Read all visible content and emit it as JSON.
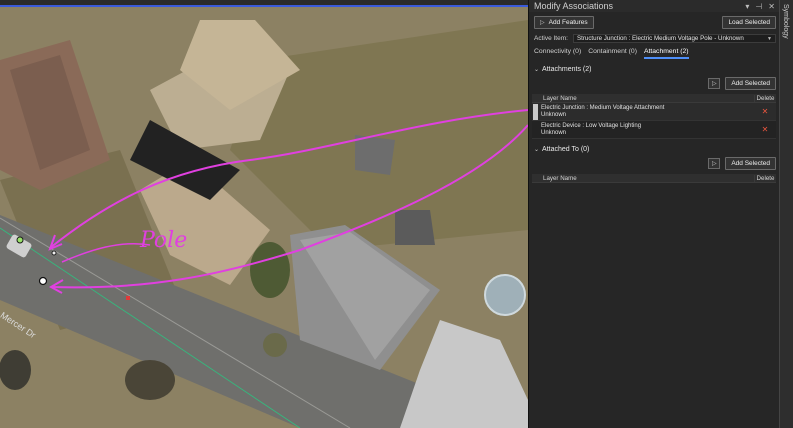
{
  "panel": {
    "title": "Modify Associations",
    "title_icons": [
      "chevron-down-icon",
      "pin-icon",
      "close-icon"
    ],
    "add_features_label": "Add Features",
    "load_selected_label": "Load Selected",
    "active_item_label": "Active Item:",
    "active_item_value": "Structure Junction : Electric Medium Voltage Pole - Unknown",
    "tabs": [
      {
        "label": "Connectivity (0)",
        "active": false
      },
      {
        "label": "Containment (0)",
        "active": false
      },
      {
        "label": "Attachment (2)",
        "active": true
      }
    ],
    "attachments": {
      "header": "Attachments (2)",
      "add_selected_label": "Add Selected",
      "columns": [
        "Layer Name",
        "Delete"
      ],
      "rows": [
        {
          "line1": "Electric Junction : Medium Voltage Attachment",
          "line2": "Unknown",
          "delete": "✕"
        },
        {
          "line1": "Electric Device : Low Voltage Lighting",
          "line2": "Unknown",
          "delete": "✕"
        }
      ]
    },
    "attached_to": {
      "header": "Attached To (0)",
      "add_selected_label": "Add Selected",
      "columns": [
        "Layer Name",
        "Delete"
      ]
    }
  },
  "side_strip_label": "Symbology",
  "map": {
    "street_label": "Mercer Dr",
    "annotation_text": "Pole",
    "annotation_color": "#e040e0",
    "accent_color": "#3b5bdb"
  }
}
